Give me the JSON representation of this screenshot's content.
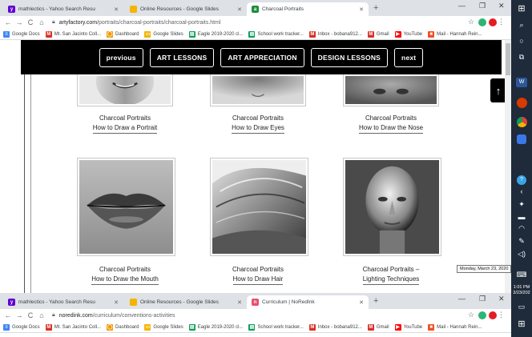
{
  "browser1": {
    "tabs": [
      {
        "label": "mathlectics - Yahoo Search Resu",
        "icon": "yahoo-mail-icon",
        "color": "#6001d2"
      },
      {
        "label": "Online Resources - Google Slides",
        "icon": "google-slides-icon",
        "color": "#f4b400"
      },
      {
        "label": "Charcoal Portraits",
        "icon": "artyfactory-icon",
        "color": "#1e8e3e"
      }
    ],
    "url_host": "artyfactory.com",
    "url_path": "/portraits/charcoal-portraits/charcoal-portraits.html"
  },
  "browser2": {
    "tabs": [
      {
        "label": "mathlectics - Yahoo Search Resu",
        "icon": "yahoo-mail-icon",
        "color": "#6001d2"
      },
      {
        "label": "Online Resources - Google Slides",
        "icon": "google-slides-icon",
        "color": "#f4b400"
      },
      {
        "label": "Curriculum | NoRedInk",
        "icon": "noredink-icon",
        "color": "#e8506c"
      }
    ],
    "url_host": "noredink.com",
    "url_path": "/curriculum/conventions-activities"
  },
  "bookmarks": [
    {
      "label": "Google Docs",
      "color": "#4285f4",
      "glyph": "≡"
    },
    {
      "label": "Mt. San Jacinto Coll...",
      "color": "#d93025",
      "glyph": "M"
    },
    {
      "label": "Dashboard",
      "color": "#f29900",
      "glyph": "◯"
    },
    {
      "label": "Google Slides",
      "color": "#f4b400",
      "glyph": "▭"
    },
    {
      "label": "Eagle 2019-2020 cl...",
      "color": "#0f9d58",
      "glyph": "▤"
    },
    {
      "label": "School work tracker...",
      "color": "#0f9d58",
      "glyph": "▤"
    },
    {
      "label": "Inbox - bobana912...",
      "color": "#d93025",
      "glyph": "M"
    },
    {
      "label": "Gmail",
      "color": "#d93025",
      "glyph": "M"
    },
    {
      "label": "YouTube",
      "color": "#ff0000",
      "glyph": "▶"
    },
    {
      "label": "Mail - Hannah Rein...",
      "color": "#f25022",
      "glyph": "■"
    }
  ],
  "site_nav": [
    "previous",
    "ART LESSONS",
    "ART APPRECIATION",
    "DESIGN LESSONS",
    "next"
  ],
  "lessons": [
    {
      "line1": "Charcoal Portraits",
      "line2": "How to Draw a Portrait"
    },
    {
      "line1": "Charcoal Portraits",
      "line2": "How to Draw Eyes"
    },
    {
      "line1": "Charcoal Portraits",
      "line2": "How to Draw the Nose"
    },
    {
      "line1": "Charcoal Portraits",
      "line2": "How to Draw the Mouth"
    },
    {
      "line1": "Charcoal Portraits",
      "line2": "How to Draw Hair"
    },
    {
      "line1": "Charcoal Portraits –",
      "line2": "Lighting Techniques"
    }
  ],
  "system": {
    "tooltip": "Monday, March 23, 2020",
    "time": "1:01 PM",
    "date": "3/23/202"
  },
  "colors": {
    "navbar_bg": "#000000",
    "tab_strip": "#dee1e6",
    "taskbar": "#1f2a3a"
  }
}
